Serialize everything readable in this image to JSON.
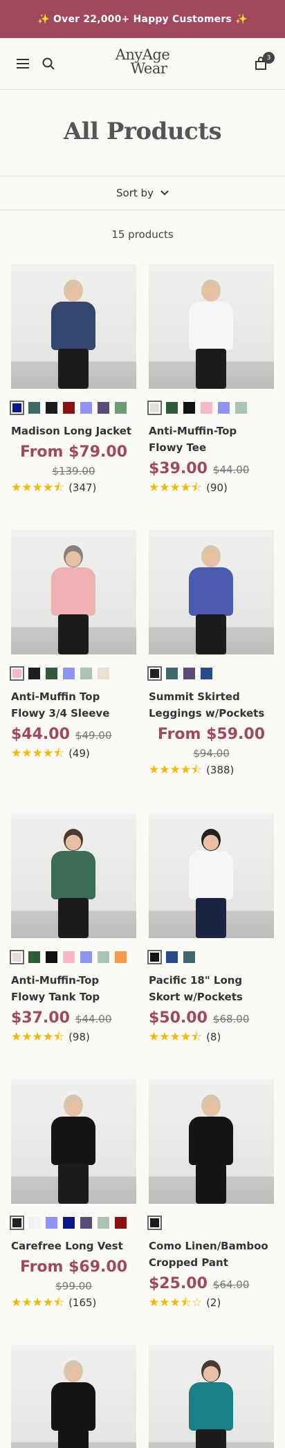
{
  "announcement": "✨ Over 22,000+ Happy Customers ✨",
  "header": {
    "logo_line1": "AnyAge",
    "logo_line2": "Wear",
    "cart_count": "3"
  },
  "page_title": "All Products",
  "sort_label": "Sort by",
  "product_count": "15 products",
  "colors": {
    "brand": "#a0485e",
    "star": "#f5b800"
  },
  "products": [
    {
      "name": "Madison Long Jacket",
      "price": "From $79.00",
      "compare": "$139.00",
      "stars": "★★★★⯪",
      "reviews": "(347)",
      "layout": "from",
      "swatches": [
        "#0b1a8a",
        "#3e6b6a",
        "#1b1b1b",
        "#8b1010",
        "#8f93f2",
        "#5a4b78",
        "#6d9b74"
      ],
      "image": {
        "top": "#33466e",
        "leg": "#1c1c1c",
        "hair": "#d8c6a8"
      }
    },
    {
      "name": "Anti-Muffin-Top Flowy Tee",
      "price": "$39.00",
      "compare": "$44.00",
      "stars": "★★★★⯪",
      "reviews": "(90)",
      "layout": "inline",
      "swatches": [
        "#e7dcd6",
        "#2f5b3b",
        "#111111",
        "#f6b7c8",
        "#8f93f2",
        "#a9c3b5"
      ],
      "image": {
        "top": "#f6f6f6",
        "leg": "#1c1c1c",
        "hair": "#d8c6a8"
      }
    },
    {
      "name": "Anti-Muffin Top Flowy 3/4 Sleeve",
      "price": "$44.00",
      "compare": "$49.00",
      "stars": "★★★★⯪",
      "reviews": "(49)",
      "layout": "inline",
      "swatches": [
        "#f6b7c8",
        "#1e1e1e",
        "#2f5b3b",
        "#8f93f2",
        "#a9c3b5",
        "#e9e1d4"
      ],
      "image": {
        "top": "#eeb1b1",
        "leg": "#1c1c1c",
        "hair": "#8a7f7b"
      }
    },
    {
      "name": "Summit Skirted Leggings w/Pockets",
      "price": "From $59.00",
      "compare": "$94.00",
      "stars": "★★★★⯪",
      "reviews": "(388)",
      "layout": "from",
      "swatches": [
        "#222222",
        "#3e6b6a",
        "#5a4b78",
        "#2a4a8a"
      ],
      "image": {
        "top": "#4a5bb0",
        "leg": "#1c1c1c",
        "hair": "#d8c6a8"
      }
    },
    {
      "name": "Anti-Muffin-Top Flowy Tank Top",
      "price": "$37.00",
      "compare": "$44.00",
      "stars": "★★★★⯪",
      "reviews": "(98)",
      "layout": "inline",
      "swatches": [
        "#e7dcd6",
        "#2f5b3b",
        "#111111",
        "#f6b7c8",
        "#8f93f2",
        "#a9c3b5",
        "#f59b50"
      ],
      "image": {
        "top": "#3e6b55",
        "leg": "#1c1c1c",
        "hair": "#4a3a30"
      }
    },
    {
      "name": "Pacific 18\" Long Skort w/Pockets",
      "price": "$50.00",
      "compare": "$68.00",
      "stars": "★★★★⯪",
      "reviews": "(8)",
      "layout": "inline",
      "swatches": [
        "#151515",
        "#2a4a8a",
        "#3e6b6a"
      ],
      "image": {
        "top": "#f6f6f6",
        "leg": "#1a2340",
        "hair": "#222222"
      }
    },
    {
      "name": "Carefree Long Vest",
      "price": "From $69.00",
      "compare": "$99.00",
      "stars": "★★★★⯪",
      "reviews": "(165)",
      "layout": "from",
      "swatches": [
        "#222222",
        "#f2f2f4",
        "#8f93f2",
        "#0b1a8a",
        "#5a4b78",
        "#a9c3b5",
        "#8b1010"
      ],
      "image": {
        "top": "#151515",
        "leg": "#1c1c1c",
        "hair": "#d8c6a8"
      }
    },
    {
      "name": "Como Linen/Bamboo Cropped Pant",
      "price": "$25.00",
      "compare": "$64.00",
      "stars": "★★★⯪☆",
      "reviews": "(2)",
      "layout": "inline",
      "swatches": [
        "#1b1b1b"
      ],
      "image": {
        "top": "#151515",
        "leg": "#151515",
        "hair": "#d8c6a8"
      }
    },
    {
      "name": "",
      "price": "",
      "compare": "",
      "stars": "",
      "reviews": "",
      "layout": "image",
      "swatches": [],
      "image": {
        "top": "#151515",
        "leg": "#151515",
        "hair": "#d8c6a8"
      }
    },
    {
      "name": "",
      "price": "",
      "compare": "",
      "stars": "",
      "reviews": "",
      "layout": "image",
      "swatches": [],
      "image": {
        "top": "#1a7f86",
        "leg": "#1c1c1c",
        "hair": "#4a3a30"
      }
    }
  ]
}
